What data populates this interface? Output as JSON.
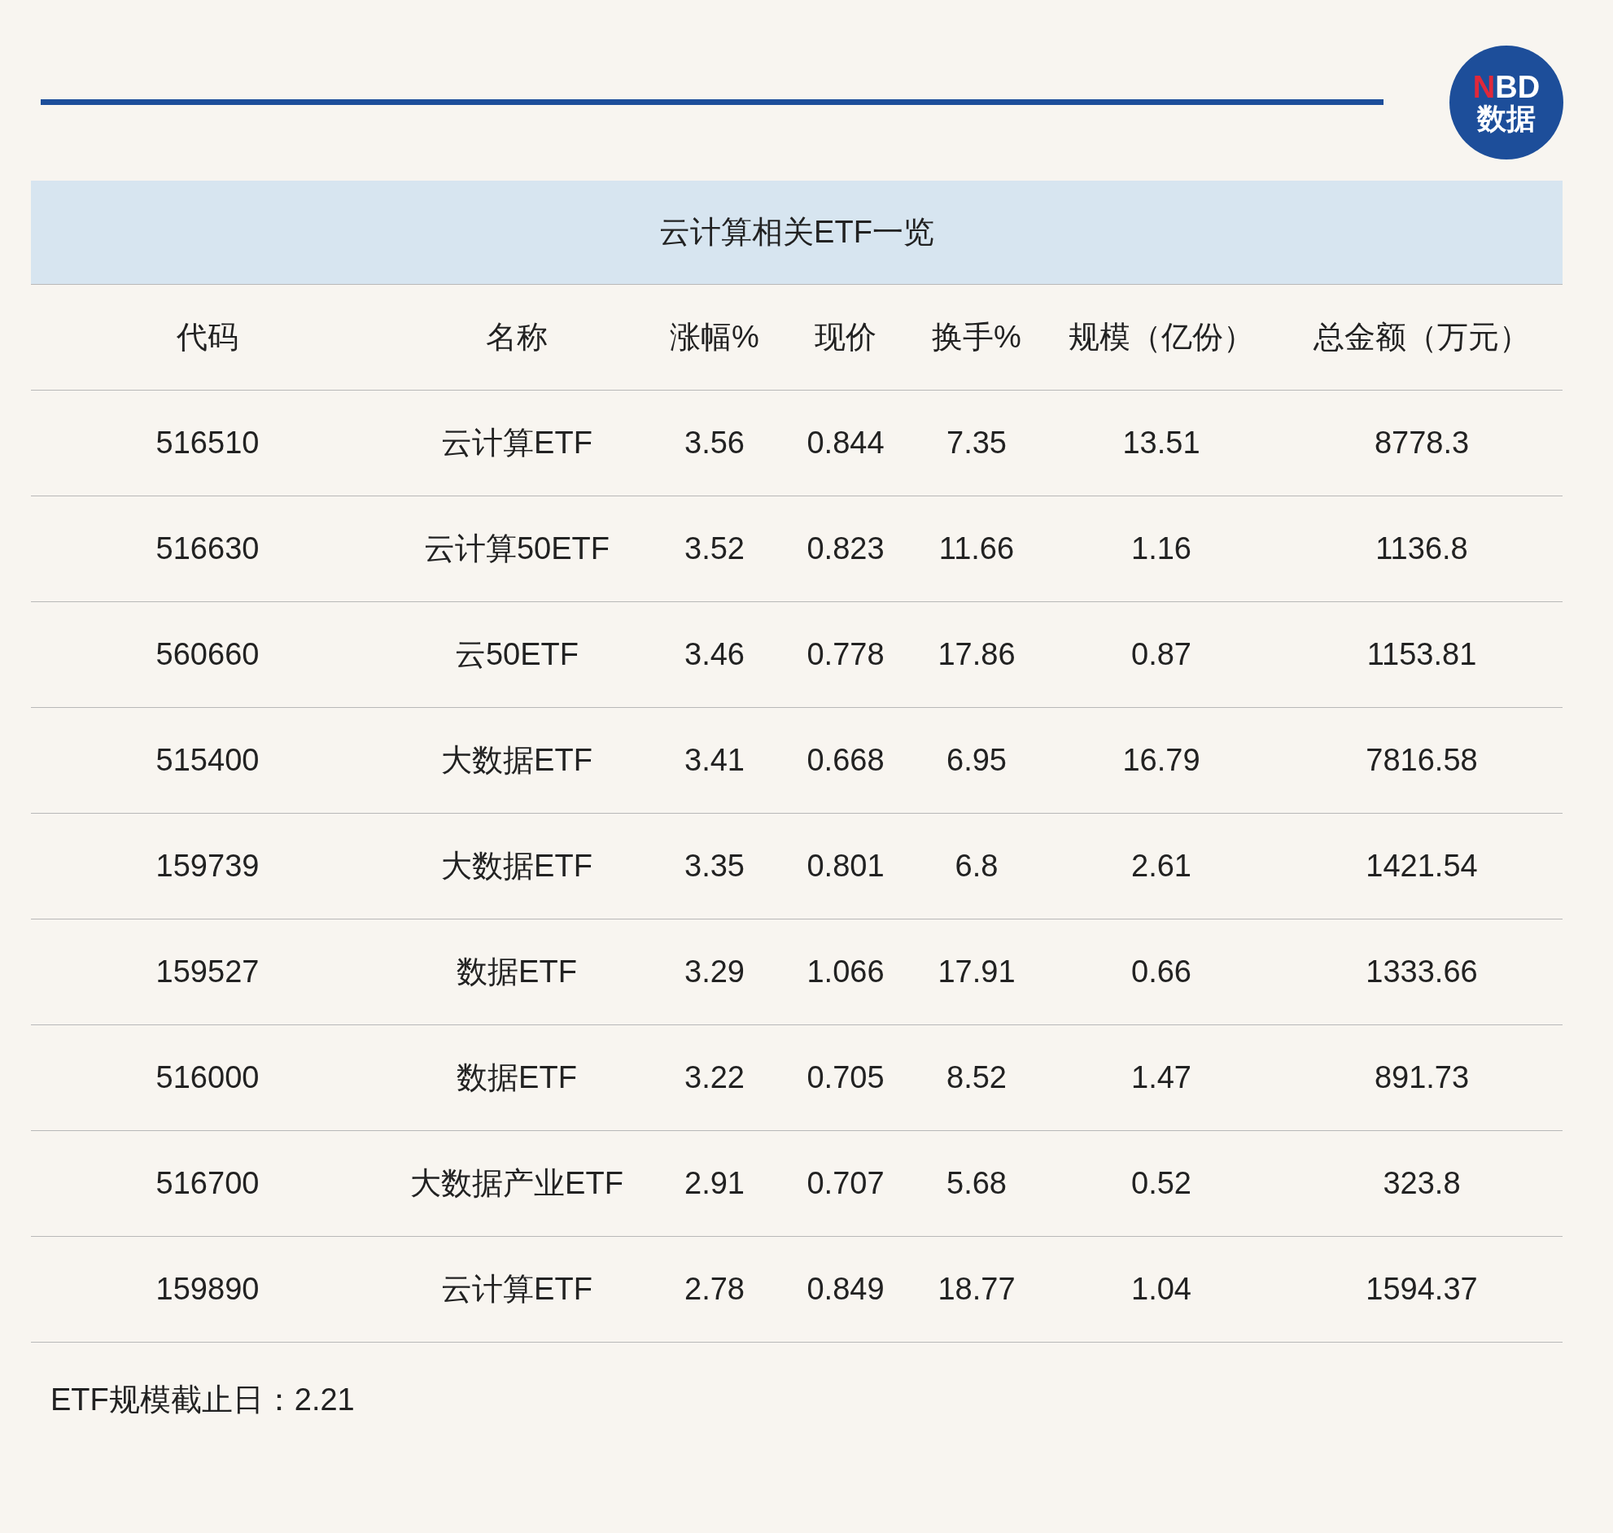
{
  "logo": {
    "accent": "N",
    "rest": "BD",
    "subtitle": "数据"
  },
  "table": {
    "title": "云计算相关ETF一览",
    "columns": [
      "代码",
      "名称",
      "涨幅%",
      "现价",
      "换手%",
      "规模（亿份）",
      "总金额（万元）"
    ],
    "rows": [
      [
        "516510",
        "云计算ETF",
        "3.56",
        "0.844",
        "7.35",
        "13.51",
        "8778.3"
      ],
      [
        "516630",
        "云计算50ETF",
        "3.52",
        "0.823",
        "11.66",
        "1.16",
        "1136.8"
      ],
      [
        "560660",
        "云50ETF",
        "3.46",
        "0.778",
        "17.86",
        "0.87",
        "1153.81"
      ],
      [
        "515400",
        "大数据ETF",
        "3.41",
        "0.668",
        "6.95",
        "16.79",
        "7816.58"
      ],
      [
        "159739",
        "大数据ETF",
        "3.35",
        "0.801",
        "6.8",
        "2.61",
        "1421.54"
      ],
      [
        "159527",
        "数据ETF",
        "3.29",
        "1.066",
        "17.91",
        "0.66",
        "1333.66"
      ],
      [
        "516000",
        "数据ETF",
        "3.22",
        "0.705",
        "8.52",
        "1.47",
        "891.73"
      ],
      [
        "516700",
        "大数据产业ETF",
        "2.91",
        "0.707",
        "5.68",
        "0.52",
        "323.8"
      ],
      [
        "159890",
        "云计算ETF",
        "2.78",
        "0.849",
        "18.77",
        "1.04",
        "1594.37"
      ]
    ]
  },
  "footnote": "ETF规模截止日：2.21"
}
